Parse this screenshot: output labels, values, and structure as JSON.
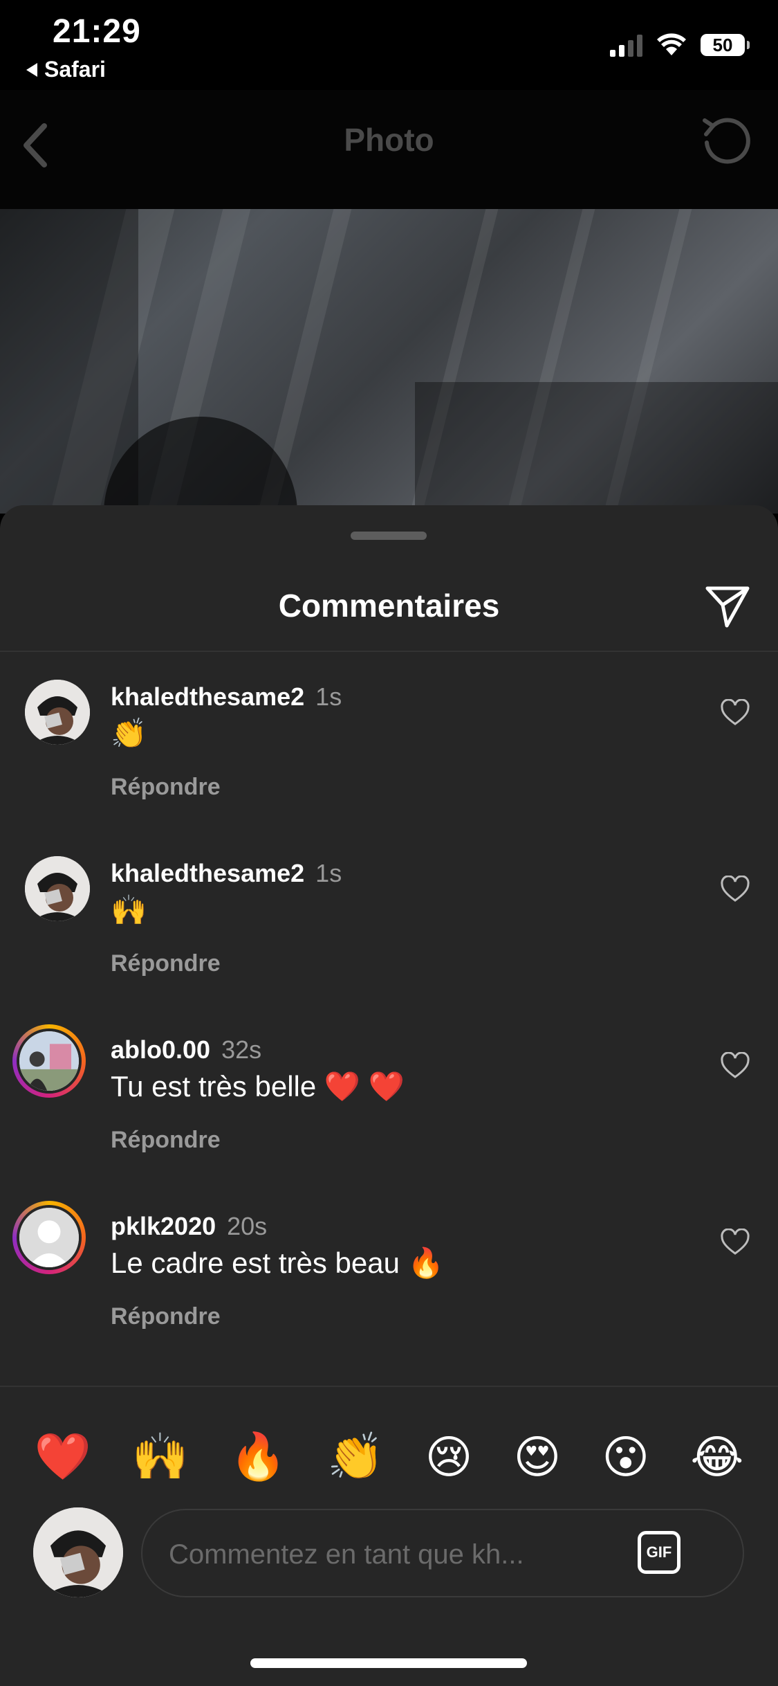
{
  "status": {
    "time": "21:29",
    "back_app": "Safari",
    "battery": "50"
  },
  "nav": {
    "title": "Photo"
  },
  "sheet": {
    "title": "Commentaires"
  },
  "comments": [
    {
      "user": "khaledthesame2",
      "time": "1s",
      "text": "👏",
      "reply": "Répondre"
    },
    {
      "user": "khaledthesame2",
      "time": "1s",
      "text": "🙌",
      "reply": "Répondre"
    },
    {
      "user": "ablo0.00",
      "time": "32s",
      "text": "Tu est très belle ❤️ ❤️",
      "reply": "Répondre"
    },
    {
      "user": "pklk2020",
      "time": "20s",
      "text": "Le cadre est très beau 🔥",
      "reply": "Répondre"
    }
  ],
  "quick_emojis": [
    "❤️",
    "🙌",
    "🔥",
    "👏",
    "😢",
    "😍",
    "😮",
    "😂"
  ],
  "composer": {
    "placeholder": "Commentez en tant que kh...",
    "gif_label": "GIF"
  },
  "colors": {
    "sheet_bg": "#262626",
    "secondary_text": "#9a9a9a",
    "story_ring": "#d3237c"
  }
}
